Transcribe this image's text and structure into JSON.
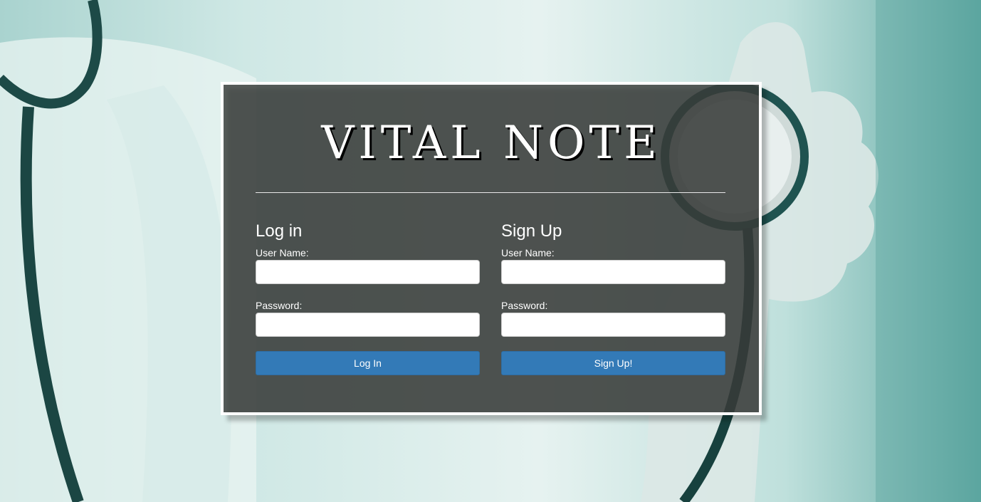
{
  "app": {
    "title": "VITAL NOTE"
  },
  "login": {
    "heading": "Log in",
    "username_label": "User Name:",
    "username_value": "",
    "password_label": "Password:",
    "password_value": "",
    "button_label": "Log In"
  },
  "signup": {
    "heading": "Sign Up",
    "username_label": "User Name:",
    "username_value": "",
    "password_label": "Password:",
    "password_value": "",
    "button_label": "Sign Up!"
  },
  "colors": {
    "accent": "#337ab7",
    "card_overlay": "#3a3e3c",
    "background_teal": "#5fa8a2"
  }
}
